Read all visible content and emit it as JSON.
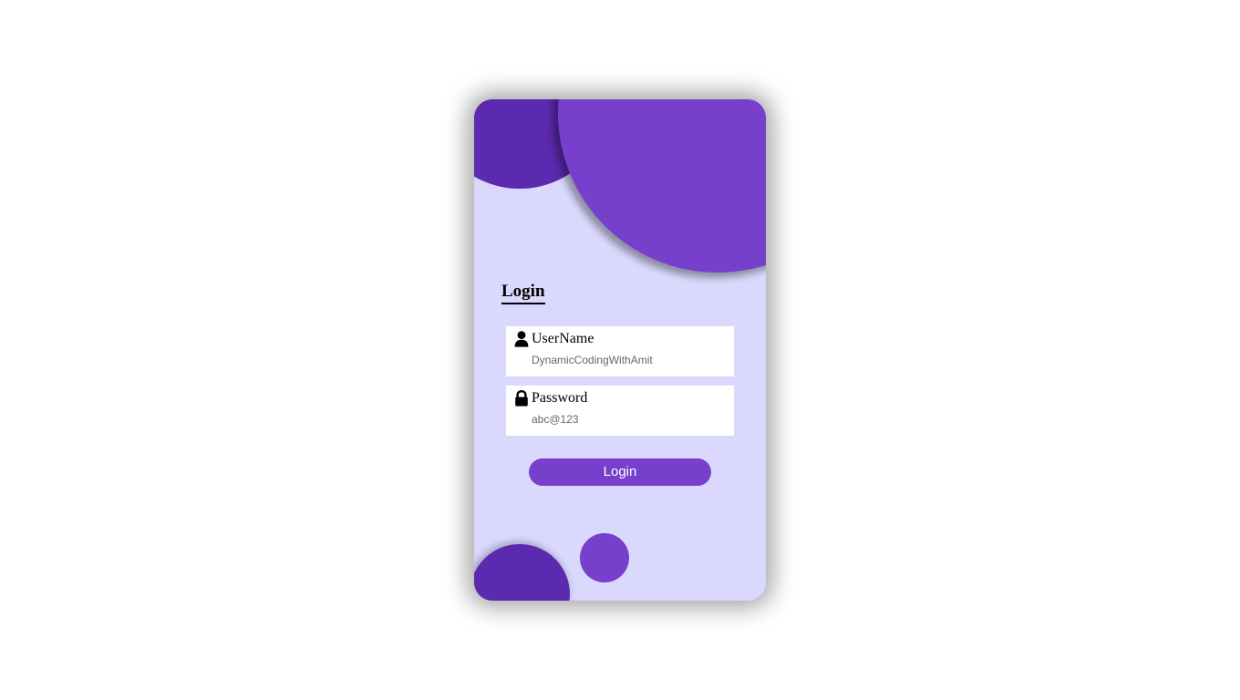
{
  "login_card": {
    "heading": "Login",
    "username": {
      "icon": "user-icon",
      "label": "UserName",
      "placeholder": "DynamicCodingWithAmit"
    },
    "password": {
      "icon": "lock-icon",
      "label": "Password",
      "placeholder": "abc@123"
    },
    "submit_label": "Login"
  },
  "colors": {
    "card_background": "#dad8fc",
    "accent_purple": "#7640cc",
    "dark_purple": "#5b2aaf",
    "field_background": "#ffffff",
    "button_text": "#ffffff"
  }
}
